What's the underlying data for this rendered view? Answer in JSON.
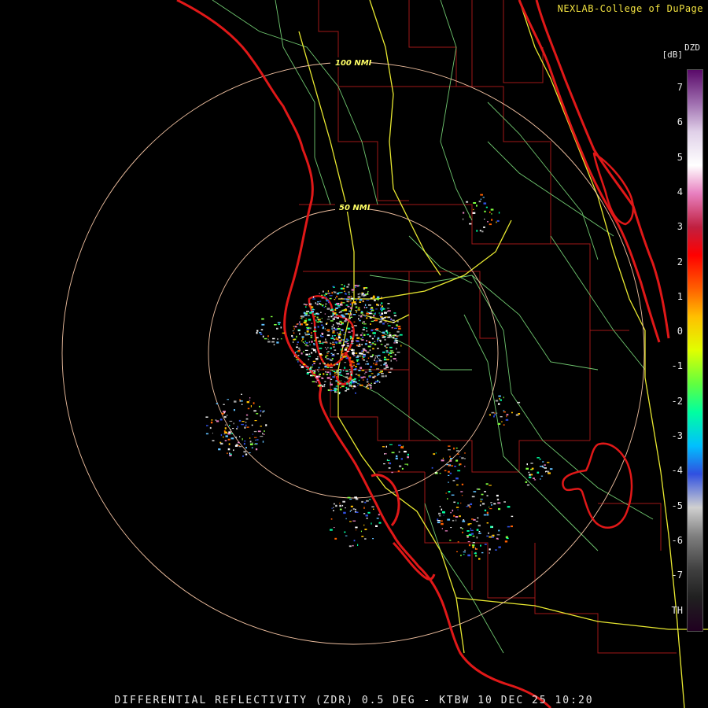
{
  "credit": "NEXLAB-College of DuPage",
  "footer": "DIFFERENTIAL REFLECTIVITY (ZDR) 0.5 DEG - KTBW 10 DEC 25 10:20",
  "legend": {
    "product": "DZD",
    "unit": "[dB]",
    "ticks": [
      "7",
      "6",
      "5",
      "4",
      "3",
      "2",
      "1",
      "0",
      "-1",
      "-2",
      "-3",
      "-4",
      "-5",
      "-6",
      "-7",
      "TH"
    ],
    "colors": [
      "#5a0a6a",
      "#a070b0",
      "#e0d0e8",
      "#ffffff",
      "#e880c0",
      "#c02040",
      "#ff0000",
      "#ff6000",
      "#ffc000",
      "#e0ff00",
      "#60ff40",
      "#00ffa0",
      "#00c0ff",
      "#3050e0",
      "#d0d0d0",
      "#808080",
      "#404040",
      "#202020",
      "#200020"
    ]
  },
  "range_rings": [
    "50 NMI",
    "100 NMI"
  ],
  "station": "KTBW",
  "colors": {
    "coastline": "#e01818",
    "county_lines": "#a01818",
    "highways": "#e8e830",
    "roads": "#70c870",
    "range_ring": "#f0c0a0"
  }
}
